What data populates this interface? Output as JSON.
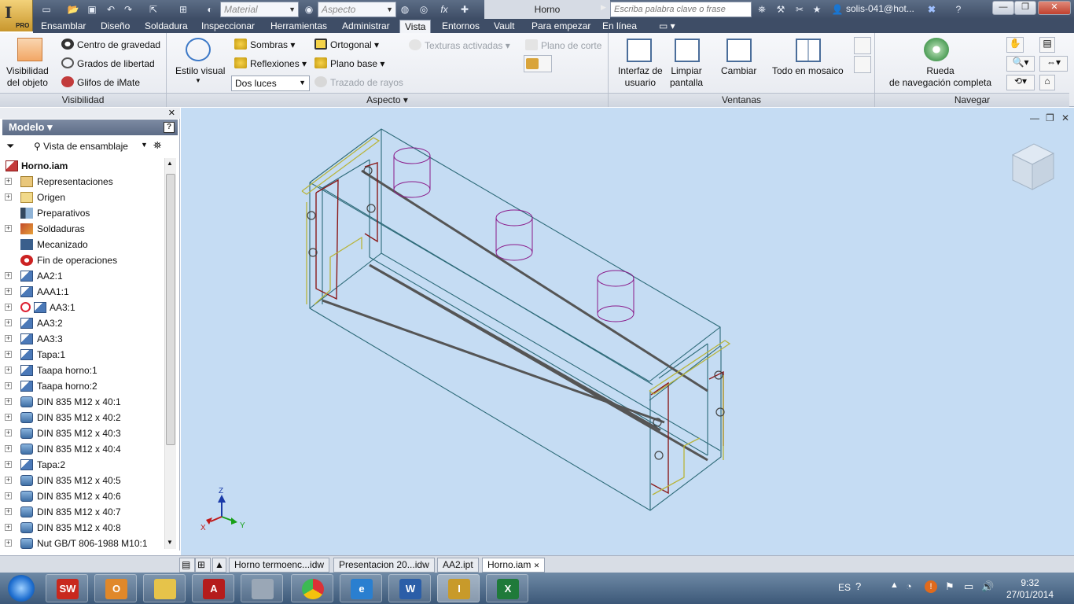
{
  "app": {
    "logo_text": "I",
    "edition": "PRO"
  },
  "titlebar": {
    "material_combo": "Material",
    "aspect_combo": "Aspecto",
    "doc_title": "Horno",
    "search_placeholder": "Escriba palabra clave o frase",
    "user": "solis-041@hot...",
    "minimize": "—",
    "restore": "❐",
    "close": "✕"
  },
  "menu_tabs": [
    "Ensamblar",
    "Diseño",
    "Soldadura",
    "Inspeccionar",
    "Herramientas",
    "Administrar",
    "Vista",
    "Entornos",
    "Vault",
    "Para empezar",
    "En línea"
  ],
  "active_tab": "Vista",
  "ribbon": {
    "visibilidad": {
      "label": "Visibilidad",
      "visibility_btn": [
        "Visibilidad",
        "del objeto"
      ],
      "centro": "Centro de gravedad",
      "grados": "Grados de libertad",
      "glifos": "Glifos de iMate"
    },
    "aspecto": {
      "label": "Aspecto",
      "estilo": "Estilo visual",
      "sombras": "Sombras",
      "reflexiones": "Reflexiones",
      "luces": "Dos luces",
      "ortogonal": "Ortogonal",
      "plano_base": "Plano base",
      "trazado": "Trazado de rayos",
      "texturas": "Texturas activadas",
      "plano_corte": "Plano de corte"
    },
    "ventanas": {
      "label": "Ventanas",
      "interfaz": [
        "Interfaz de",
        "usuario"
      ],
      "limpiar": [
        "Limpiar",
        "pantalla"
      ],
      "cambiar": "Cambiar",
      "mosaico": "Todo en mosaico"
    },
    "navegar": {
      "label": "Navegar",
      "rueda": [
        "Rueda",
        "de navegación completa"
      ]
    }
  },
  "browser": {
    "title": "Modelo",
    "view": "Vista de ensamblaje",
    "root": "Horno.iam",
    "items": [
      {
        "label": "Representaciones",
        "expand": true,
        "icon": "folder-rep"
      },
      {
        "label": "Origen",
        "expand": true,
        "icon": "folder"
      },
      {
        "label": "Preparativos",
        "expand": false,
        "icon": "prep"
      },
      {
        "label": "Soldaduras",
        "expand": true,
        "icon": "weld"
      },
      {
        "label": "Mecanizado",
        "expand": false,
        "icon": "machining"
      },
      {
        "label": "Fin de operaciones",
        "expand": false,
        "icon": "end"
      },
      {
        "label": "AA2:1",
        "expand": true,
        "icon": "part"
      },
      {
        "label": "AAA1:1",
        "expand": true,
        "icon": "part"
      },
      {
        "label": "AA3:1",
        "expand": true,
        "icon": "part-update"
      },
      {
        "label": "AA3:2",
        "expand": true,
        "icon": "part"
      },
      {
        "label": "AA3:3",
        "expand": true,
        "icon": "part"
      },
      {
        "label": "Tapa:1",
        "expand": true,
        "icon": "part"
      },
      {
        "label": "Taapa horno:1",
        "expand": true,
        "icon": "part"
      },
      {
        "label": "Taapa horno:2",
        "expand": true,
        "icon": "part"
      },
      {
        "label": "DIN 835 M12 x 40:1",
        "expand": true,
        "icon": "bolt"
      },
      {
        "label": "DIN 835 M12 x 40:2",
        "expand": true,
        "icon": "bolt"
      },
      {
        "label": "DIN 835 M12 x 40:3",
        "expand": true,
        "icon": "bolt"
      },
      {
        "label": "DIN 835 M12 x 40:4",
        "expand": true,
        "icon": "bolt"
      },
      {
        "label": "Tapa:2",
        "expand": true,
        "icon": "part"
      },
      {
        "label": "DIN 835 M12 x 40:5",
        "expand": true,
        "icon": "bolt"
      },
      {
        "label": "DIN 835 M12 x 40:6",
        "expand": true,
        "icon": "bolt"
      },
      {
        "label": "DIN 835 M12 x 40:7",
        "expand": true,
        "icon": "bolt"
      },
      {
        "label": "DIN 835 M12 x 40:8",
        "expand": true,
        "icon": "bolt"
      },
      {
        "label": "Nut GB/T 806-1988 M10:1",
        "expand": true,
        "icon": "bolt"
      }
    ]
  },
  "axes": {
    "x": "X",
    "y": "Y",
    "z": "Z"
  },
  "doc_tabs": [
    "Horno termoenc...idw",
    "Presentacion 20...idw",
    "AA2.ipt",
    "Horno.iam"
  ],
  "active_doc": "Horno.iam",
  "taskbar": {
    "apps": [
      {
        "name": "start",
        "label": ""
      },
      {
        "name": "solidworks",
        "label": "SW"
      },
      {
        "name": "outlook",
        "label": "O"
      },
      {
        "name": "explorer",
        "label": ""
      },
      {
        "name": "acrobat",
        "label": "A"
      },
      {
        "name": "calculator",
        "label": ""
      },
      {
        "name": "chrome",
        "label": ""
      },
      {
        "name": "ie",
        "label": "e"
      },
      {
        "name": "word",
        "label": "W"
      },
      {
        "name": "inventor",
        "label": "I"
      },
      {
        "name": "excel",
        "label": "X"
      }
    ],
    "lang": "ES",
    "time": "9:32",
    "date": "27/01/2014"
  },
  "colors": {
    "accent": "#3e4d66",
    "viewport": "#c5dcf3",
    "model_line": "#2d6a78",
    "frame_red": "#8b1a1a",
    "rail_dark": "#555555",
    "yellow": "#b8b43a",
    "magenta": "#8a1a8a"
  }
}
